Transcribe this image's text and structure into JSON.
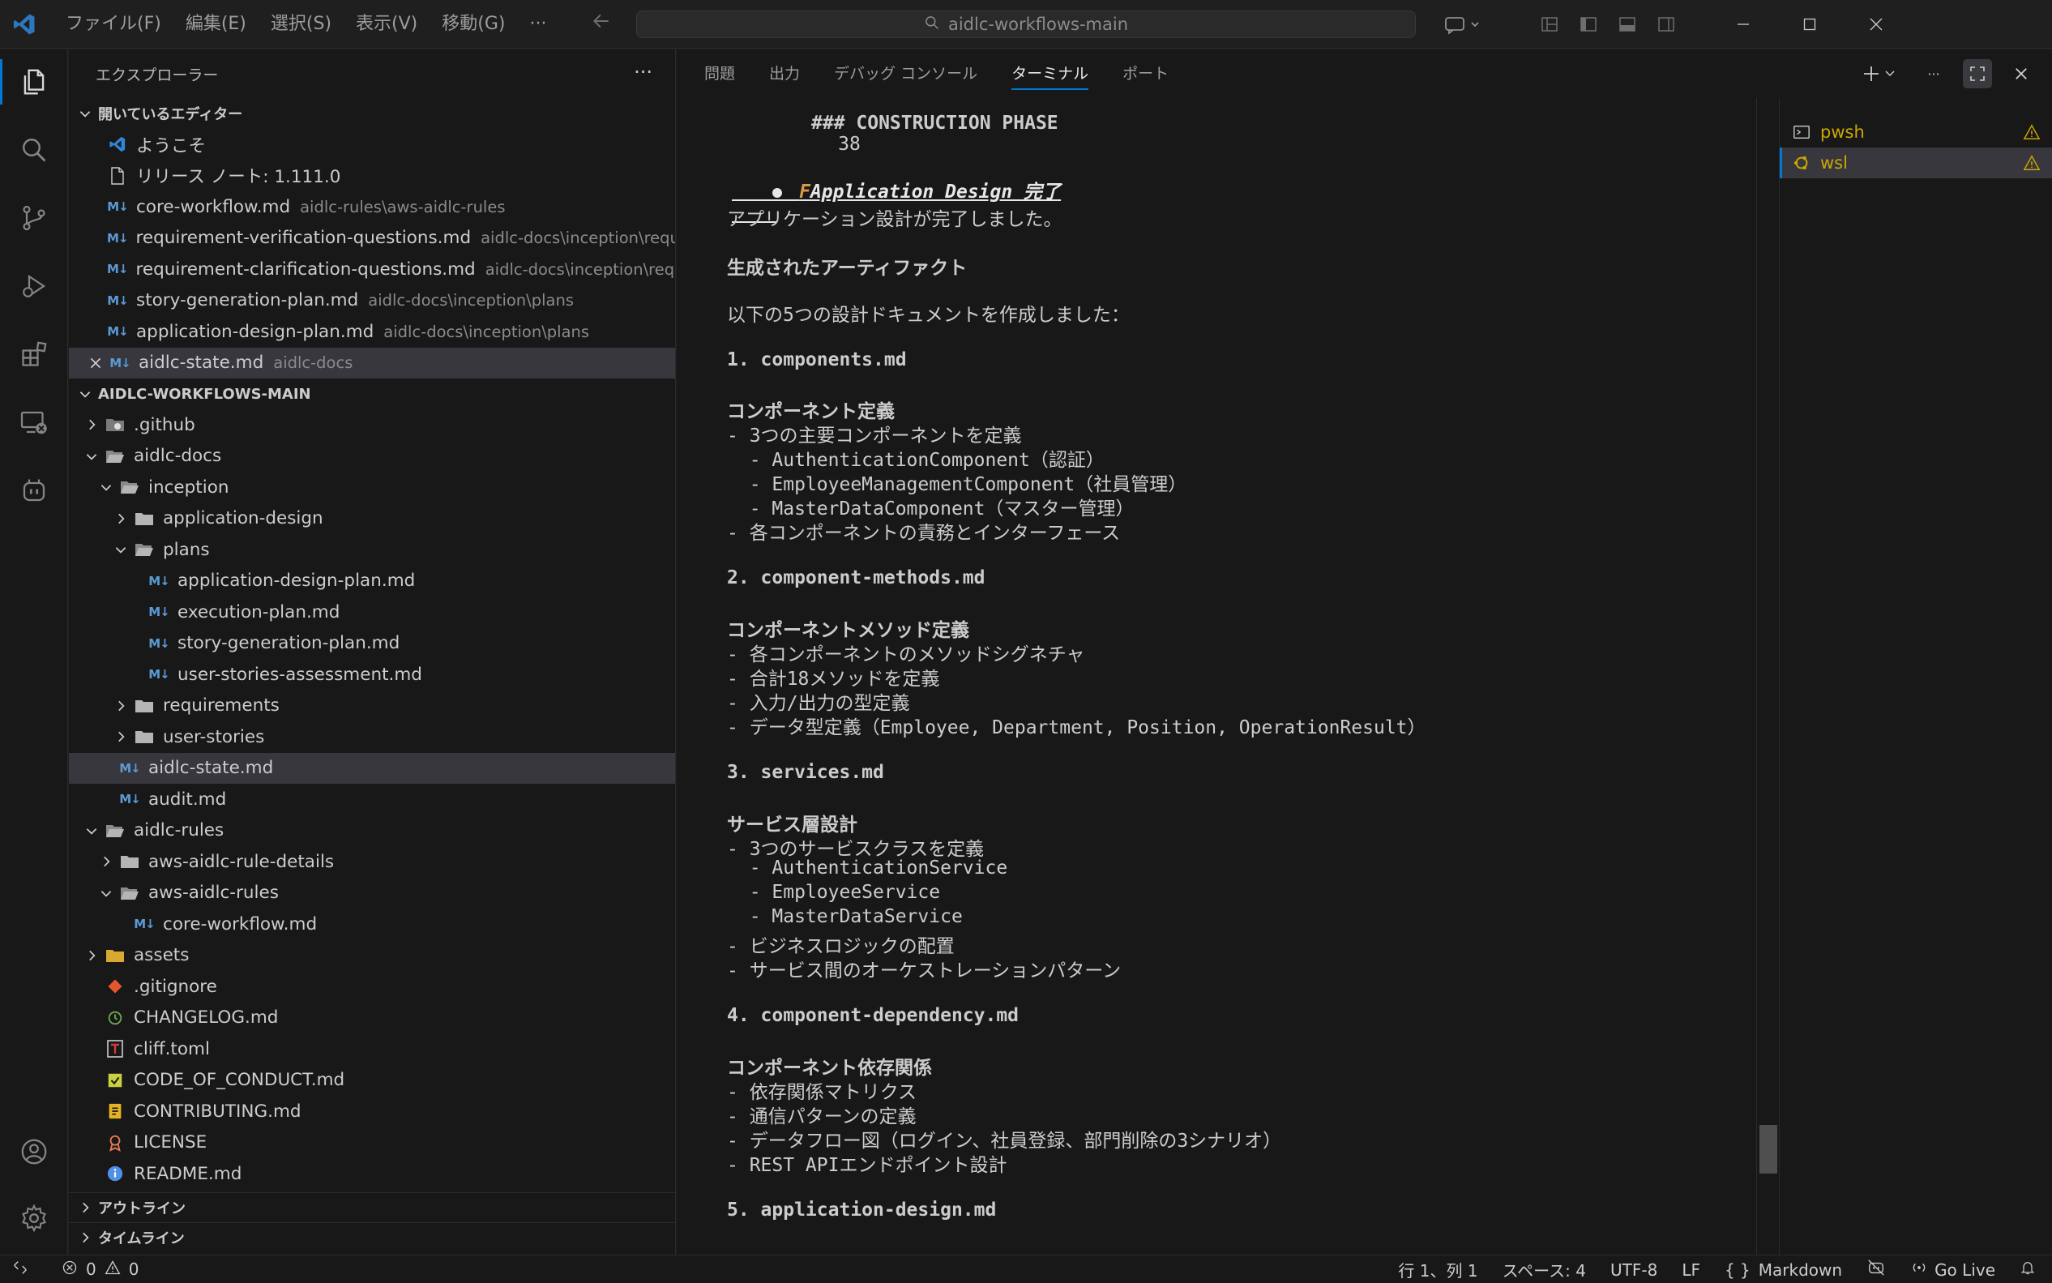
{
  "window": {
    "search_text": "aidlc-workflows-main"
  },
  "menu": [
    "ファイル(F)",
    "編集(E)",
    "選択(S)",
    "表示(V)",
    "移動(G)",
    "···"
  ],
  "sidebar": {
    "header": "エクスプローラー",
    "open_editors_title": "開いているエディター",
    "open_editors": [
      {
        "name": "ようこそ",
        "desc": "",
        "icon": "vscode-icon"
      },
      {
        "name": "リリース ノート: 1.111.0",
        "desc": "",
        "icon": "file-icon"
      },
      {
        "name": "core-workflow.md",
        "desc": "aidlc-rules\\aws-aidlc-rules",
        "icon": "markdown-icon"
      },
      {
        "name": "requirement-verification-questions.md",
        "desc": "aidlc-docs\\inception\\requir...",
        "icon": "markdown-icon"
      },
      {
        "name": "requirement-clarification-questions.md",
        "desc": "aidlc-docs\\inception\\requi...",
        "icon": "markdown-icon"
      },
      {
        "name": "story-generation-plan.md",
        "desc": "aidlc-docs\\inception\\plans",
        "icon": "markdown-icon"
      },
      {
        "name": "application-design-plan.md",
        "desc": "aidlc-docs\\inception\\plans",
        "icon": "markdown-icon"
      },
      {
        "name": "aidlc-state.md",
        "desc": "aidlc-docs",
        "icon": "markdown-icon"
      }
    ],
    "workspace_title": "AIDLC-WORKFLOWS-MAIN",
    "tree": [
      {
        "name": ".github",
        "depth": 0,
        "type": "folder",
        "open": false
      },
      {
        "name": "aidlc-docs",
        "depth": 0,
        "type": "folder",
        "open": true
      },
      {
        "name": "inception",
        "depth": 1,
        "type": "folder",
        "open": true
      },
      {
        "name": "application-design",
        "depth": 2,
        "type": "folder",
        "open": false
      },
      {
        "name": "plans",
        "depth": 2,
        "type": "folder",
        "open": true
      },
      {
        "name": "application-design-plan.md",
        "depth": 3,
        "type": "md"
      },
      {
        "name": "execution-plan.md",
        "depth": 3,
        "type": "md"
      },
      {
        "name": "story-generation-plan.md",
        "depth": 3,
        "type": "md"
      },
      {
        "name": "user-stories-assessment.md",
        "depth": 3,
        "type": "md"
      },
      {
        "name": "requirements",
        "depth": 2,
        "type": "folder",
        "open": false
      },
      {
        "name": "user-stories",
        "depth": 2,
        "type": "folder",
        "open": false
      },
      {
        "name": "aidlc-state.md",
        "depth": 1,
        "type": "md"
      },
      {
        "name": "audit.md",
        "depth": 1,
        "type": "md"
      },
      {
        "name": "aidlc-rules",
        "depth": 0,
        "type": "folder",
        "open": true
      },
      {
        "name": "aws-aidlc-rule-details",
        "depth": 1,
        "type": "folder",
        "open": false
      },
      {
        "name": "aws-aidlc-rules",
        "depth": 1,
        "type": "folder",
        "open": true
      },
      {
        "name": "core-workflow.md",
        "depth": 2,
        "type": "md"
      },
      {
        "name": "assets",
        "depth": 0,
        "type": "folder",
        "open": false
      },
      {
        "name": ".gitignore",
        "depth": 0,
        "type": "git"
      },
      {
        "name": "CHANGELOG.md",
        "depth": 0,
        "type": "changelog"
      },
      {
        "name": "cliff.toml",
        "depth": 0,
        "type": "toml"
      },
      {
        "name": "CODE_OF_CONDUCT.md",
        "depth": 0,
        "type": "conduct"
      },
      {
        "name": "CONTRIBUTING.md",
        "depth": 0,
        "type": "contrib"
      },
      {
        "name": "LICENSE",
        "depth": 0,
        "type": "license"
      },
      {
        "name": "README.md",
        "depth": 0,
        "type": "readme"
      }
    ],
    "outline_title": "アウトライン",
    "timeline_title": "タイムライン"
  },
  "panel": {
    "tabs": [
      "問題",
      "出力",
      "デバッグ コンソール",
      "ターミナル",
      "ポート"
    ],
    "active_tab": "ターミナル",
    "terminals": [
      {
        "name": "pwsh"
      },
      {
        "name": "wsl"
      }
    ]
  },
  "terminal": {
    "line_no": "38",
    "line_38": "### CONSTRUCTION PHASE",
    "title": "Application Design 完了",
    "intro": "アプリケーション設計が完了しました。",
    "artifacts_heading": "生成されたアーティファクト",
    "artifacts_intro": "以下の5つの設計ドキュメントを作成しました：",
    "s1_title": "1. components.md",
    "s1_heading": "コンポーネント定義",
    "s1_l1": "- 3つの主要コンポーネントを定義",
    "s1_l2": "  - AuthenticationComponent（認証）",
    "s1_l3": "  - EmployeeManagementComponent（社員管理）",
    "s1_l4": "  - MasterDataComponent（マスター管理）",
    "s1_l5": "- 各コンポーネントの責務とインターフェース",
    "s2_title": "2. component-methods.md",
    "s2_heading": "コンポーネントメソッド定義",
    "s2_l1": "- 各コンポーネントのメソッドシグネチャ",
    "s2_l2": "- 合計18メソッドを定義",
    "s2_l3": "- 入力/出力の型定義",
    "s2_l4": "- データ型定義（Employee, Department, Position, OperationResult）",
    "s3_title": "3. services.md",
    "s3_heading": "サービス層設計",
    "s3_l1": "- 3つのサービスクラスを定義",
    "s3_l2": "  - AuthenticationService",
    "s3_l3": "  - EmployeeService",
    "s3_l4": "  - MasterDataService",
    "s3_l5": "- ビジネスロジックの配置",
    "s3_l6": "- サービス間のオーケストレーションパターン",
    "s4_title": "4. component-dependency.md",
    "s4_heading": "コンポーネント依存関係",
    "s4_l1": "- 依存関係マトリクス",
    "s4_l2": "- 通信パターンの定義",
    "s4_l3": "- データフロー図（ログイン、社員登録、部門削除の3シナリオ）",
    "s4_l4": "- REST APIエンドポイント設計",
    "s5_title": "5. application-design.md"
  },
  "status": {
    "errors": "0",
    "warnings": "0",
    "position": "行 1、列 1",
    "spaces": "スペース: 4",
    "encoding": "UTF-8",
    "eol": "LF",
    "language": "Markdown",
    "go_live": "Go Live"
  },
  "colors": {
    "accent": "#0078d4",
    "warning": "#cca700",
    "markdown": "#5b9bd5",
    "folder": "#c5c5c5"
  }
}
